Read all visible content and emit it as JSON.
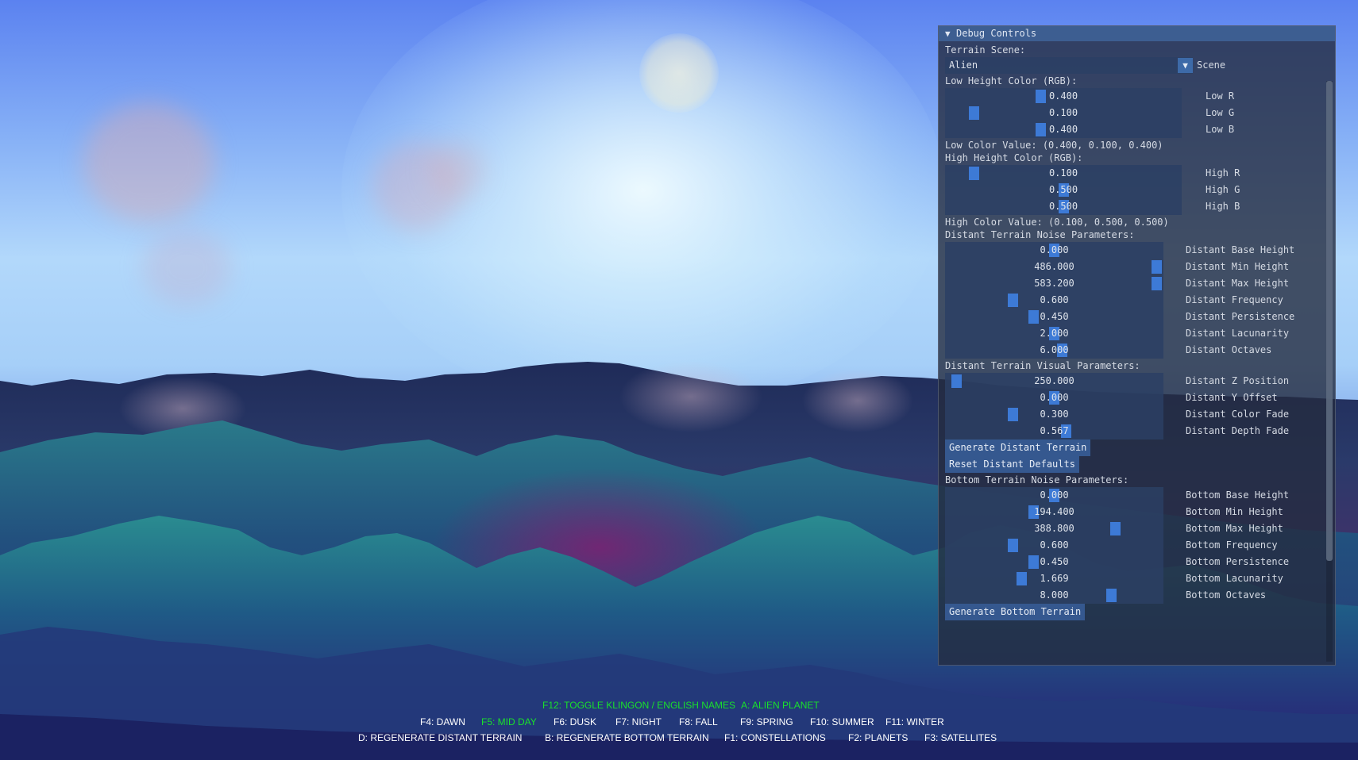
{
  "panel": {
    "title": "Debug Controls",
    "collapse_glyph": "▼",
    "terrain_scene_label": "Terrain Scene:",
    "scene_combo": {
      "value": "Alien",
      "label": "Scene",
      "arrow": "▼"
    },
    "low_color_header": "Low Height Color (RGB):",
    "low_sliders": [
      {
        "value": "0.400",
        "label": "Low R",
        "fraction": 0.4
      },
      {
        "value": "0.100",
        "label": "Low G",
        "fraction": 0.1
      },
      {
        "value": "0.400",
        "label": "Low B",
        "fraction": 0.4
      }
    ],
    "low_color_value": "Low Color Value: (0.400, 0.100, 0.400)",
    "high_color_header": "High Height Color (RGB):",
    "high_sliders": [
      {
        "value": "0.100",
        "label": "High R",
        "fraction": 0.1
      },
      {
        "value": "0.500",
        "label": "High G",
        "fraction": 0.5
      },
      {
        "value": "0.500",
        "label": "High B",
        "fraction": 0.5
      }
    ],
    "high_color_value": "High Color Value: (0.100, 0.500, 0.500)",
    "distant_noise_header": "Distant Terrain Noise Parameters:",
    "distant_noise_sliders": [
      {
        "value": "0.000",
        "label": "Distant Base Height",
        "fraction": 0.5
      },
      {
        "value": "486.000",
        "label": "Distant Min Height",
        "fraction": 1.0
      },
      {
        "value": "583.200",
        "label": "Distant Max Height",
        "fraction": 1.0
      },
      {
        "value": "0.600",
        "label": "Distant Frequency",
        "fraction": 0.3
      },
      {
        "value": "0.450",
        "label": "Distant Persistence",
        "fraction": 0.4
      },
      {
        "value": "2.000",
        "label": "Distant Lacunarity",
        "fraction": 0.5
      },
      {
        "value": "6.000",
        "label": "Distant Octaves",
        "fraction": 0.54
      }
    ],
    "distant_visual_header": "Distant Terrain Visual Parameters:",
    "distant_visual_sliders": [
      {
        "value": "250.000",
        "label": "Distant Z Position",
        "fraction": 0.025
      },
      {
        "value": "0.000",
        "label": "Distant Y Offset",
        "fraction": 0.5
      },
      {
        "value": "0.300",
        "label": "Distant Color Fade",
        "fraction": 0.3
      },
      {
        "value": "0.567",
        "label": "Distant Depth Fade",
        "fraction": 0.56
      }
    ],
    "generate_distant_button": "Generate Distant Terrain",
    "reset_distant_button": "Reset Distant Defaults",
    "bottom_noise_header": "Bottom Terrain Noise Parameters:",
    "bottom_noise_sliders": [
      {
        "value": "0.000",
        "label": "Bottom Base Height",
        "fraction": 0.5
      },
      {
        "value": "194.400",
        "label": "Bottom Min Height",
        "fraction": 0.4
      },
      {
        "value": "388.800",
        "label": "Bottom Max Height",
        "fraction": 0.8
      },
      {
        "value": "0.600",
        "label": "Bottom Frequency",
        "fraction": 0.3
      },
      {
        "value": "0.450",
        "label": "Bottom Persistence",
        "fraction": 0.4
      },
      {
        "value": "1.669",
        "label": "Bottom Lacunarity",
        "fraction": 0.34
      },
      {
        "value": "8.000",
        "label": "Bottom Octaves",
        "fraction": 0.78
      }
    ],
    "generate_bottom_button": "Generate Bottom Terrain"
  },
  "help": {
    "line1": [
      {
        "text": "F12: TOGGLE KLINGON / ENGLISH NAMES",
        "highlighted": true
      },
      {
        "text": "A: ALIEN PLANET",
        "highlighted": true
      }
    ],
    "line2": [
      {
        "text": "F4: DAWN",
        "highlighted": false
      },
      {
        "text": "F5: MID DAY",
        "highlighted": true
      },
      {
        "text": "F6: DUSK",
        "highlighted": false
      },
      {
        "text": "F7: NIGHT",
        "highlighted": false
      },
      {
        "text": "F8: FALL",
        "highlighted": false
      },
      {
        "text": "F9: SPRING",
        "highlighted": false
      },
      {
        "text": "F10: SUMMER",
        "highlighted": false
      },
      {
        "text": "F11: WINTER",
        "highlighted": false
      }
    ],
    "line3": [
      {
        "text": "D: REGENERATE DISTANT TERRAIN",
        "highlighted": false
      },
      {
        "text": "B: REGENERATE BOTTOM TERRAIN",
        "highlighted": false
      },
      {
        "text": "F1: CONSTELLATIONS",
        "highlighted": false
      },
      {
        "text": "F2: PLANETS",
        "highlighted": false
      },
      {
        "text": "F3: SATELLITES",
        "highlighted": false
      }
    ]
  },
  "colors": {
    "highlight_text": "#19e02c",
    "normal_text": "#ffffff",
    "slider_grab": "#3d7ad6",
    "title_bar": "#3d5e91",
    "low_height_color": "#661a66",
    "high_height_color": "#1a8080"
  }
}
